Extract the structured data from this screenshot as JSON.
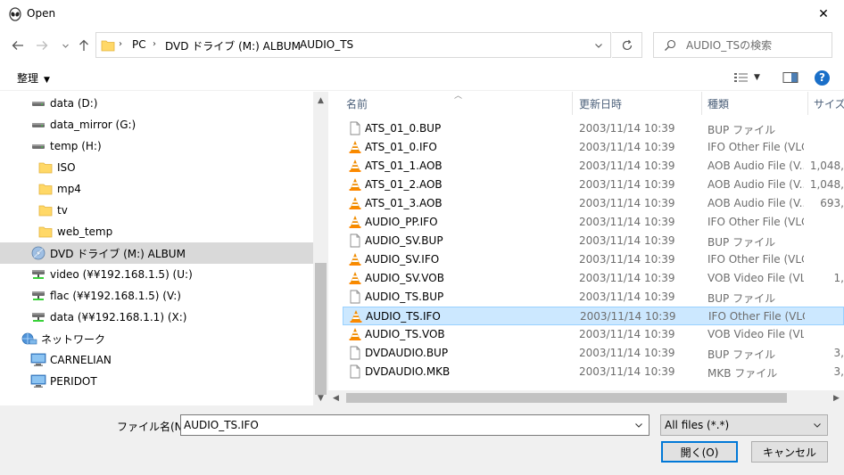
{
  "window": {
    "title": "Open",
    "close_glyph": "✕"
  },
  "nav": {
    "breadcrumbs": [
      "PC",
      "DVD ドライブ (M:) ALBUM",
      "AUDIO_TS"
    ],
    "search_placeholder": "AUDIO_TSの検索"
  },
  "toolbar": {
    "organize_label": "整理",
    "help_glyph": "?"
  },
  "tree": [
    {
      "label": "data (D:)",
      "icon": "drive-icon",
      "indent": 34
    },
    {
      "label": "data_mirror (G:)",
      "icon": "drive-icon",
      "indent": 34
    },
    {
      "label": "temp (H:)",
      "icon": "drive-icon",
      "indent": 34
    },
    {
      "label": "ISO",
      "icon": "folder-icon",
      "indent": 42
    },
    {
      "label": "mp4",
      "icon": "folder-icon",
      "indent": 42
    },
    {
      "label": "tv",
      "icon": "folder-icon",
      "indent": 42
    },
    {
      "label": "web_temp",
      "icon": "folder-icon",
      "indent": 42
    },
    {
      "label": "DVD ドライブ (M:) ALBUM",
      "icon": "dvd-icon",
      "indent": 34,
      "selected": true
    },
    {
      "label": "video (¥¥192.168.1.5) (U:)",
      "icon": "network-drive-icon",
      "indent": 34
    },
    {
      "label": "flac (¥¥192.168.1.5) (V:)",
      "icon": "network-drive-icon",
      "indent": 34
    },
    {
      "label": "data (¥¥192.168.1.1) (X:)",
      "icon": "network-drive-icon",
      "indent": 34
    },
    {
      "label": "ネットワーク",
      "icon": "network-icon",
      "indent": 24
    },
    {
      "label": "CARNELIAN",
      "icon": "computer-icon",
      "indent": 34
    },
    {
      "label": "PERIDOT",
      "icon": "computer-icon",
      "indent": 34
    }
  ],
  "columns": {
    "name": "名前",
    "date": "更新日時",
    "type": "種類",
    "size": "サイズ"
  },
  "files": [
    {
      "name": "ATS_01_0.BUP",
      "date": "2003/11/14 10:39",
      "type": "BUP ファイル",
      "size": "",
      "icon": "file-icon"
    },
    {
      "name": "ATS_01_0.IFO",
      "date": "2003/11/14 10:39",
      "type": "IFO Other File (VLC)",
      "size": "",
      "icon": "vlc-cone-icon"
    },
    {
      "name": "ATS_01_1.AOB",
      "date": "2003/11/14 10:39",
      "type": "AOB Audio File (V...",
      "size": "1,048,",
      "icon": "vlc-cone-icon"
    },
    {
      "name": "ATS_01_2.AOB",
      "date": "2003/11/14 10:39",
      "type": "AOB Audio File (V...",
      "size": "1,048,",
      "icon": "vlc-cone-icon"
    },
    {
      "name": "ATS_01_3.AOB",
      "date": "2003/11/14 10:39",
      "type": "AOB Audio File (V...",
      "size": "693,",
      "icon": "vlc-cone-icon"
    },
    {
      "name": "AUDIO_PP.IFO",
      "date": "2003/11/14 10:39",
      "type": "IFO Other File (VLC)",
      "size": "",
      "icon": "vlc-cone-icon"
    },
    {
      "name": "AUDIO_SV.BUP",
      "date": "2003/11/14 10:39",
      "type": "BUP ファイル",
      "size": "",
      "icon": "file-icon"
    },
    {
      "name": "AUDIO_SV.IFO",
      "date": "2003/11/14 10:39",
      "type": "IFO Other File (VLC)",
      "size": "",
      "icon": "vlc-cone-icon"
    },
    {
      "name": "AUDIO_SV.VOB",
      "date": "2003/11/14 10:39",
      "type": "VOB Video File (VL...",
      "size": "1,",
      "icon": "vlc-cone-icon"
    },
    {
      "name": "AUDIO_TS.BUP",
      "date": "2003/11/14 10:39",
      "type": "BUP ファイル",
      "size": "",
      "icon": "file-icon"
    },
    {
      "name": "AUDIO_TS.IFO",
      "date": "2003/11/14 10:39",
      "type": "IFO Other File (VLC)",
      "size": "",
      "icon": "vlc-cone-icon",
      "selected": true
    },
    {
      "name": "AUDIO_TS.VOB",
      "date": "2003/11/14 10:39",
      "type": "VOB Video File (VL...",
      "size": "",
      "icon": "vlc-cone-icon"
    },
    {
      "name": "DVDAUDIO.BUP",
      "date": "2003/11/14 10:39",
      "type": "BUP ファイル",
      "size": "3,",
      "icon": "file-icon"
    },
    {
      "name": "DVDAUDIO.MKB",
      "date": "2003/11/14 10:39",
      "type": "MKB ファイル",
      "size": "3,",
      "icon": "file-icon"
    }
  ],
  "footer": {
    "filename_label": "ファイル名(N):",
    "filename_value": "AUDIO_TS.IFO",
    "filetype_value": "All files (*.*)",
    "open_label": "開く(O)",
    "cancel_label": "キャンセル"
  },
  "colors": {
    "selection": "#cce8ff",
    "selection_border": "#99d1ff",
    "accent": "#0078d7",
    "vlc_orange": "#f08c00"
  }
}
